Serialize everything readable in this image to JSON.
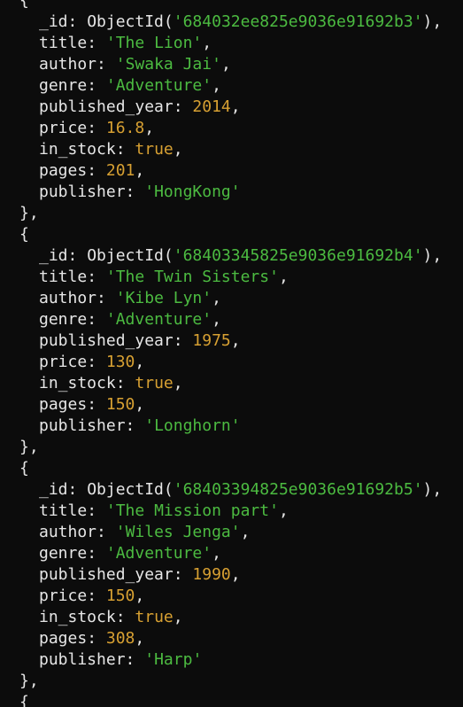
{
  "colors": {
    "background": "#0c0c0c",
    "key": "#e6e6e6",
    "string": "#4cbb41",
    "number": "#d7a032",
    "boolean": "#d7a032"
  },
  "syntax": {
    "open_brace": "{",
    "close_brace_comma": "},",
    "object_id_fn": "ObjectId"
  },
  "documents": [
    {
      "_id": "684032ee825e9036e91692b3",
      "title": "The Lion",
      "author": "Swaka Jai",
      "genre": "Adventure",
      "published_year": "2014",
      "price": "16.8",
      "in_stock": "true",
      "pages": "201",
      "publisher": "HongKong"
    },
    {
      "_id": "68403345825e9036e91692b4",
      "title": "The Twin Sisters",
      "author": "Kibe Lyn",
      "genre": "Adventure",
      "published_year": "1975",
      "price": "130",
      "in_stock": "true",
      "pages": "150",
      "publisher": "Longhorn"
    },
    {
      "_id": "68403394825e9036e91692b5",
      "title": "The Mission part",
      "author": "Wiles Jenga",
      "genre": "Adventure",
      "published_year": "1990",
      "price": "150",
      "in_stock": "true",
      "pages": "308",
      "publisher": "Harp"
    },
    {}
  ]
}
